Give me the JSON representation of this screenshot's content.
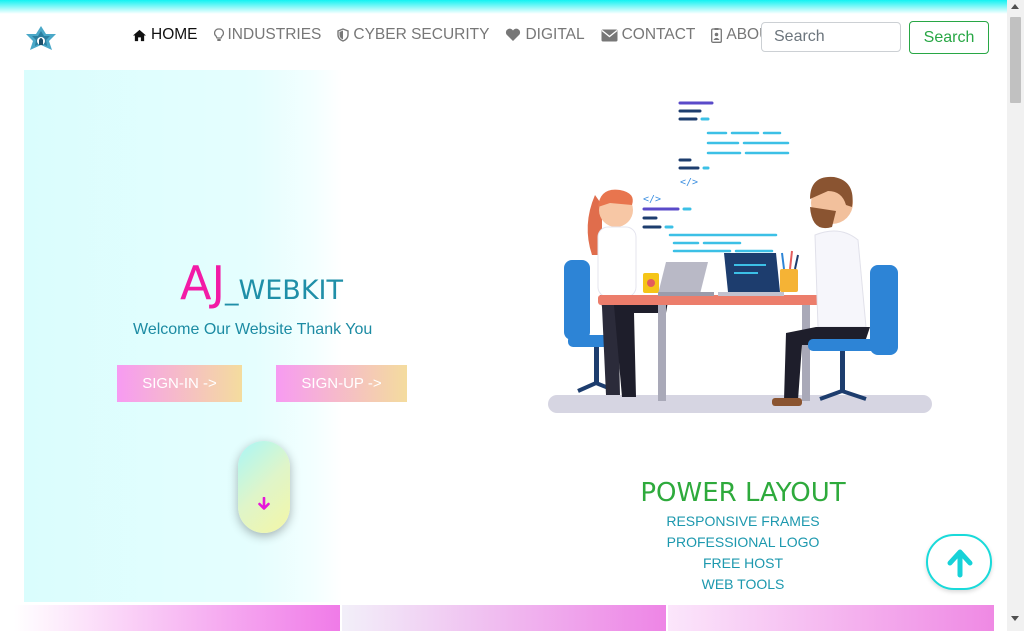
{
  "nav": {
    "items": [
      {
        "label": "HOME",
        "icon": "home-icon",
        "active": true
      },
      {
        "label": "INDUSTRIES",
        "icon": "lightbulb-icon",
        "active": false
      },
      {
        "label": "CYBER SECURITY",
        "icon": "shield-icon",
        "active": false
      },
      {
        "label": "DIGITAL",
        "icon": "heart-icon",
        "active": false
      },
      {
        "label": "CONTACT",
        "icon": "envelope-icon",
        "active": false
      },
      {
        "label": "ABOUT",
        "icon": "id-badge-icon",
        "active": false
      }
    ],
    "search_placeholder": "Search",
    "search_button": "Search"
  },
  "hero": {
    "brand_main": "AJ",
    "brand_sub": "_WEBKIT",
    "tagline": "Welcome Our Website Thank You",
    "signin_label": "SIGN-IN ->",
    "signup_label": "SIGN-UP ->",
    "scroll_icon": "arrow-down-icon"
  },
  "features": {
    "title": "POWER LAYOUT",
    "items": [
      "RESPONSIVE FRAMES",
      "PROFESSIONAL LOGO",
      "FREE HOST",
      "WEB TOOLS"
    ]
  },
  "back_to_top_icon": "arrow-up-icon",
  "colors": {
    "accent_cyan": "#12f2f2",
    "brand_pink": "#f21ba6",
    "teal_text": "#1c8ba3",
    "green": "#2eaa3c",
    "search_green": "#28a745"
  }
}
